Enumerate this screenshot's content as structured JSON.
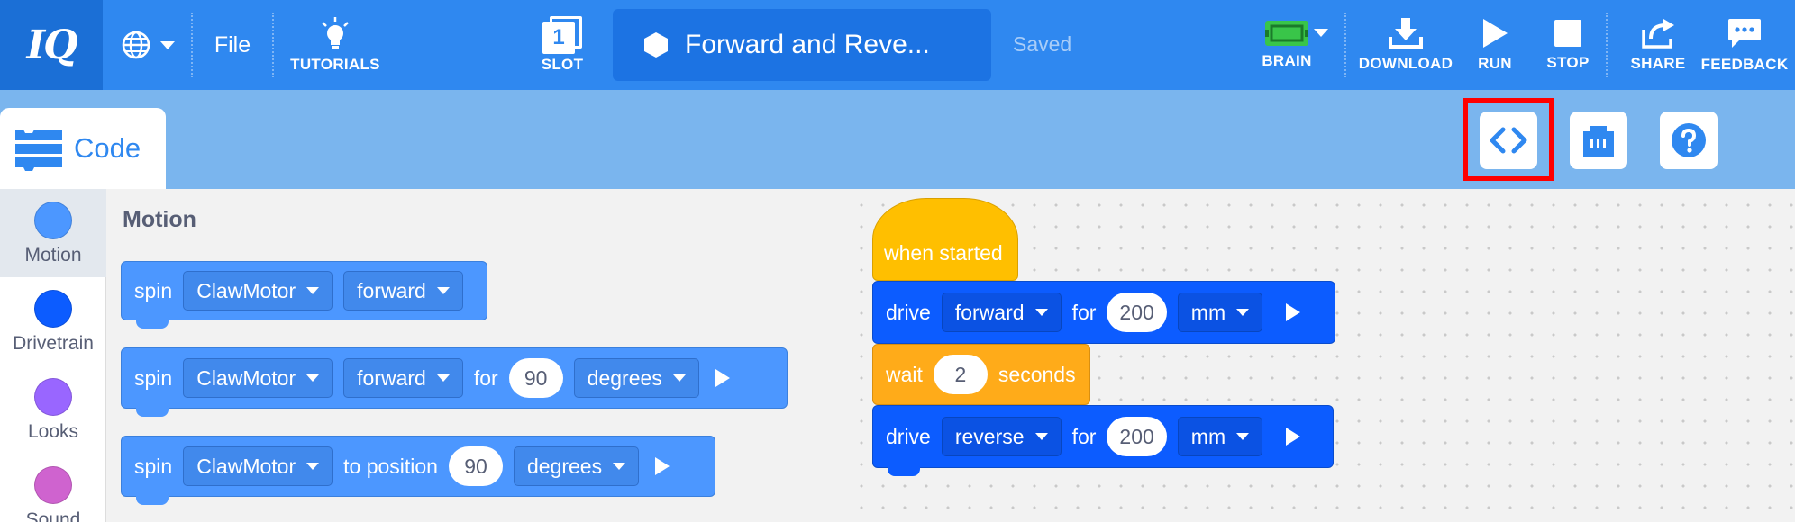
{
  "topbar": {
    "logo": "IQ",
    "language_icon": "globe-icon",
    "file_label": "File",
    "tutorials_label": "TUTORIALS",
    "slot_number": "1",
    "slot_label": "SLOT",
    "project_title": "Forward and Reve...",
    "save_status": "Saved",
    "brain_label": "BRAIN",
    "download_label": "DOWNLOAD",
    "run_label": "RUN",
    "stop_label": "STOP",
    "share_label": "SHARE",
    "feedback_label": "FEEDBACK",
    "colors": {
      "bar": "#2f88f0",
      "logo_bg": "#1b6fd6",
      "title_box": "#1c73e3",
      "brain_green": "#39c549"
    }
  },
  "subheader": {
    "code_tab_label": "Code",
    "buttons": [
      "code-view-icon",
      "device-icon",
      "help-icon"
    ],
    "highlight_color": "#ff0000"
  },
  "categories": [
    {
      "name": "Motion",
      "color": "#4c97ff"
    },
    {
      "name": "Drivetrain",
      "color": "#0c5cff"
    },
    {
      "name": "Looks",
      "color": "#9966ff"
    },
    {
      "name": "Sound",
      "color": "#cf63cf"
    }
  ],
  "flyout": {
    "title": "Motion",
    "blocks": [
      {
        "op": "spin",
        "motor": "ClawMotor",
        "direction": "forward"
      },
      {
        "op": "spin",
        "motor": "ClawMotor",
        "direction": "forward",
        "for_label": "for",
        "amount": "90",
        "unit": "degrees"
      },
      {
        "op": "spin",
        "motor": "ClawMotor",
        "position_label": "to position",
        "amount": "90",
        "unit": "degrees"
      }
    ]
  },
  "workspace": {
    "hat_label": "when started",
    "drive1": {
      "op": "drive",
      "direction": "forward",
      "for_label": "for",
      "amount": "200",
      "unit": "mm"
    },
    "wait": {
      "op": "wait",
      "amount": "2",
      "unit_label": "seconds"
    },
    "drive2": {
      "op": "drive",
      "direction": "reverse",
      "for_label": "for",
      "amount": "200",
      "unit": "mm"
    }
  }
}
